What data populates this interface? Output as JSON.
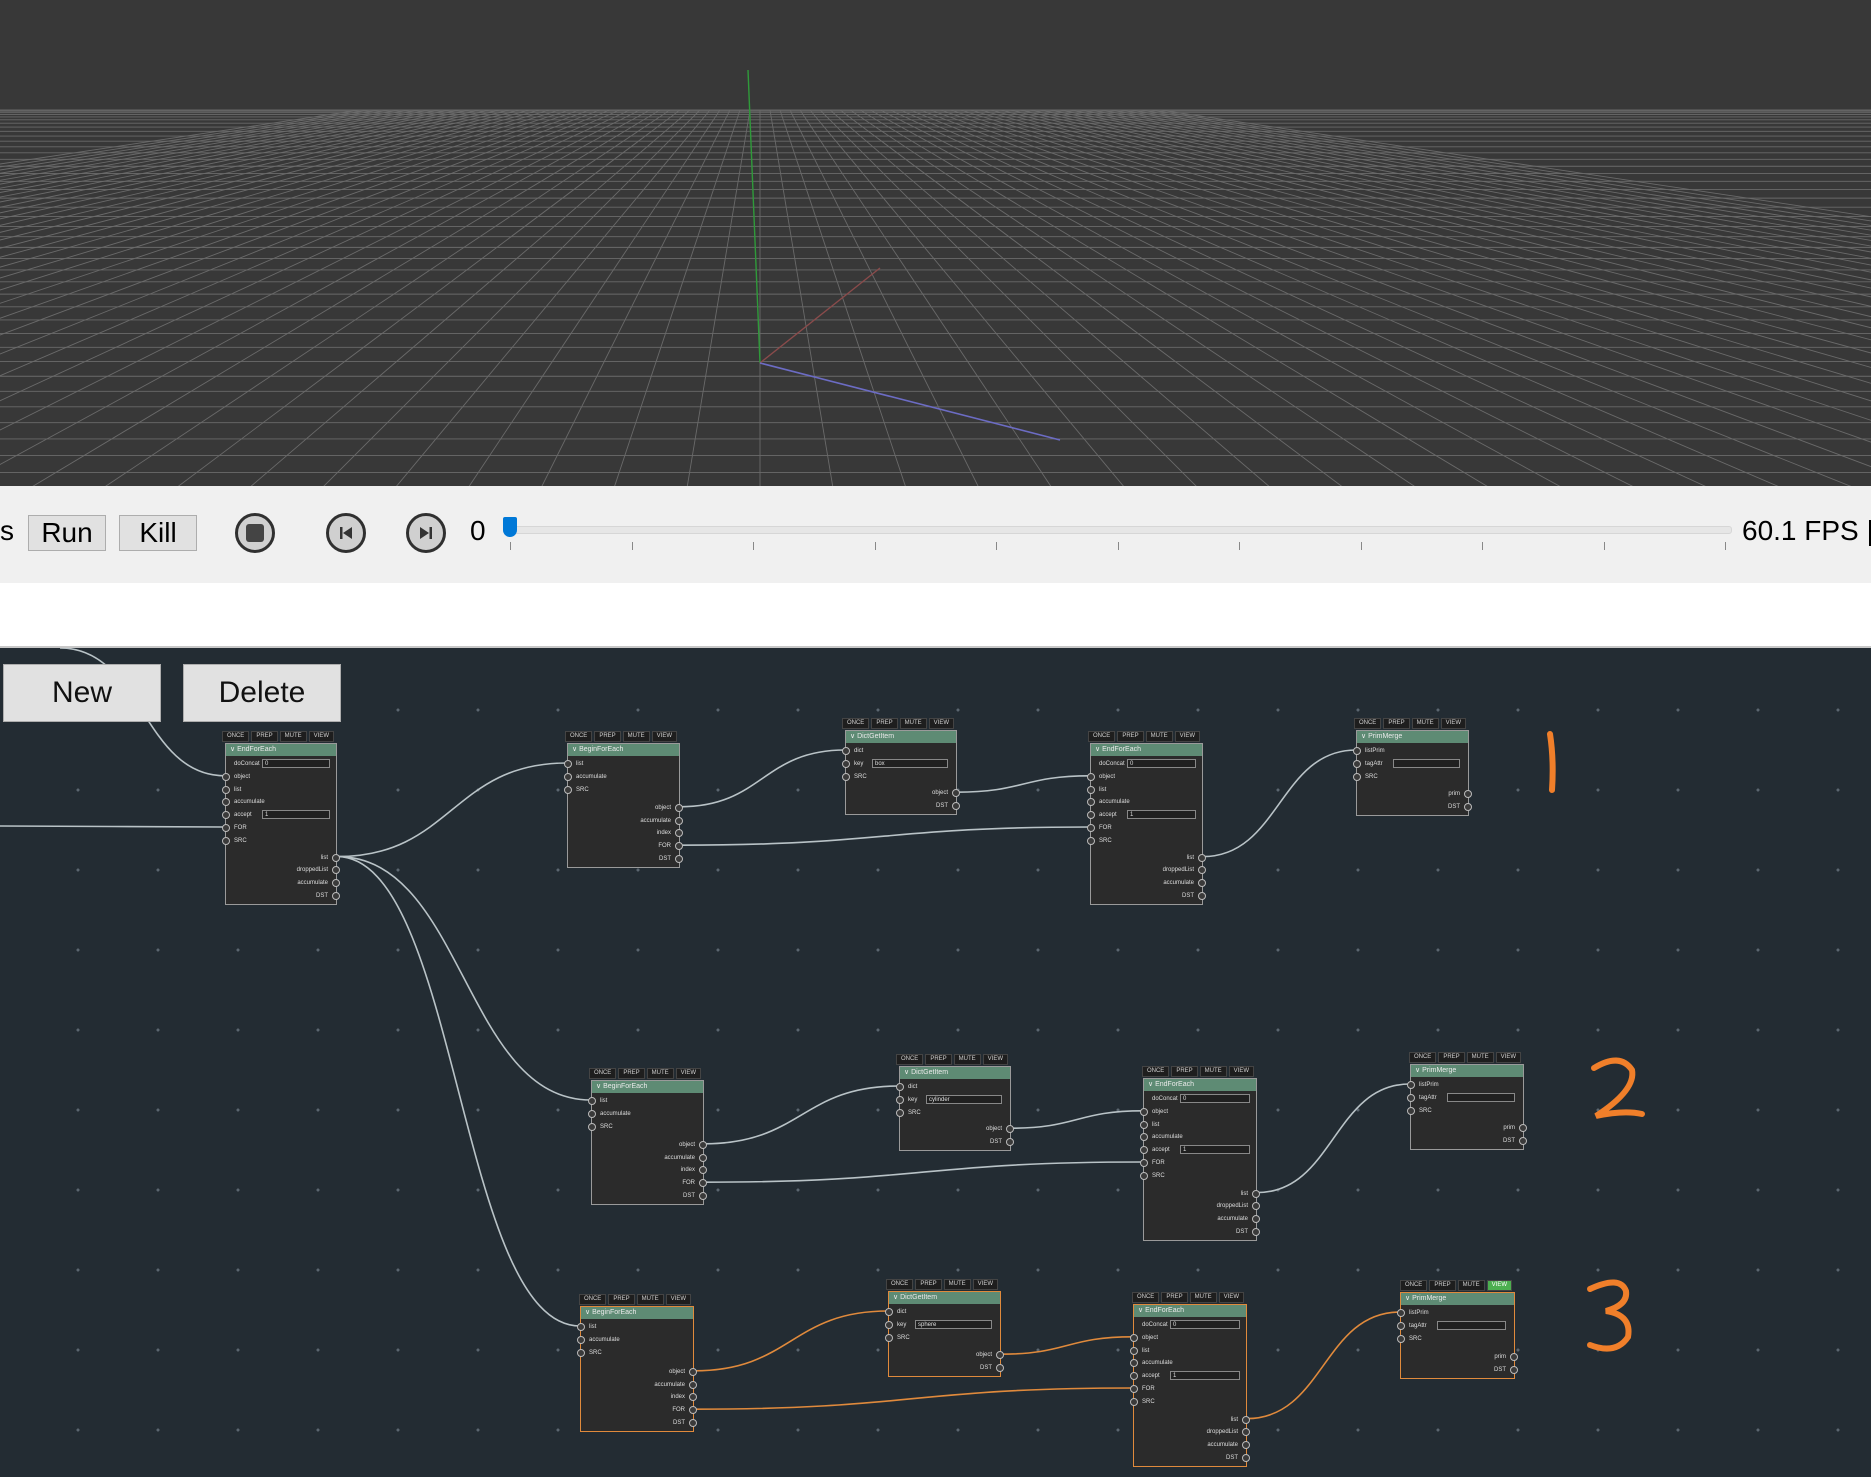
{
  "toolbar": {
    "edge_label": "s",
    "run_label": "Run",
    "kill_label": "Kill",
    "stop_icon": "stop-circle-icon",
    "prev_icon": "skip-back-icon",
    "next_icon": "skip-forward-icon",
    "frame_value": "0",
    "timeline_position": 0,
    "fps_label": "60.1 FPS |"
  },
  "graph_toolbar": {
    "new_label": "New",
    "delete_label": "Delete"
  },
  "node_controls": [
    "ONCE",
    "PREP",
    "MUTE",
    "VIEW"
  ],
  "colors": {
    "viewport_bg": "#383838",
    "editor_bg": "#232c33",
    "node_header": "#5e8b74",
    "wire": "#b9c3c7",
    "selected_wire": "#e08a3c",
    "annotation": "#f07f2a",
    "view_on": "#4caf50"
  },
  "annotations": [
    "1",
    "2",
    "3"
  ],
  "nodes": {
    "main_end": {
      "title": "EndForEach",
      "fields": {
        "doConcat": "0",
        "accept": "1"
      },
      "inputs": [
        "doConcat",
        "object",
        "list",
        "accumulate",
        "accept",
        "FOR",
        "SRC"
      ],
      "outputs": [
        "list",
        "droppedList",
        "accumulate",
        "DST"
      ]
    },
    "g1_begin": {
      "title": "BeginForEach",
      "inputs": [
        "list",
        "accumulate",
        "SRC"
      ],
      "outputs": [
        "object",
        "accumulate",
        "index",
        "FOR",
        "DST"
      ]
    },
    "g1_dict": {
      "title": "DictGetItem",
      "inputs": [
        "dict",
        "key",
        "SRC"
      ],
      "key_value": "box",
      "outputs": [
        "object",
        "DST"
      ]
    },
    "g1_end": {
      "title": "EndForEach",
      "fields": {
        "doConcat": "0",
        "accept": "1"
      },
      "inputs": [
        "doConcat",
        "object",
        "list",
        "accumulate",
        "accept",
        "FOR",
        "SRC"
      ],
      "outputs": [
        "list",
        "droppedList",
        "accumulate",
        "DST"
      ]
    },
    "g1_merge": {
      "title": "PrimMerge",
      "inputs": [
        "listPrim",
        "tagAttr",
        "SRC"
      ],
      "outputs": [
        "prim",
        "DST"
      ]
    },
    "g2_begin": {
      "title": "BeginForEach",
      "inputs": [
        "list",
        "accumulate",
        "SRC"
      ],
      "outputs": [
        "object",
        "accumulate",
        "index",
        "FOR",
        "DST"
      ]
    },
    "g2_dict": {
      "title": "DictGetItem",
      "inputs": [
        "dict",
        "key",
        "SRC"
      ],
      "key_value": "cylinder",
      "outputs": [
        "object",
        "DST"
      ]
    },
    "g2_end": {
      "title": "EndForEach",
      "fields": {
        "doConcat": "0",
        "accept": "1"
      },
      "inputs": [
        "doConcat",
        "object",
        "list",
        "accumulate",
        "accept",
        "FOR",
        "SRC"
      ],
      "outputs": [
        "list",
        "droppedList",
        "accumulate",
        "DST"
      ]
    },
    "g2_merge": {
      "title": "PrimMerge",
      "inputs": [
        "listPrim",
        "tagAttr",
        "SRC"
      ],
      "outputs": [
        "prim",
        "DST"
      ]
    },
    "g3_begin": {
      "title": "BeginForEach",
      "inputs": [
        "list",
        "accumulate",
        "SRC"
      ],
      "outputs": [
        "object",
        "accumulate",
        "index",
        "FOR",
        "DST"
      ]
    },
    "g3_dict": {
      "title": "DictGetItem",
      "inputs": [
        "dict",
        "key",
        "SRC"
      ],
      "key_value": "sphere",
      "outputs": [
        "object",
        "DST"
      ]
    },
    "g3_end": {
      "title": "EndForEach",
      "fields": {
        "doConcat": "0",
        "accept": "1"
      },
      "inputs": [
        "doConcat",
        "object",
        "list",
        "accumulate",
        "accept",
        "FOR",
        "SRC"
      ],
      "outputs": [
        "list",
        "droppedList",
        "accumulate",
        "DST"
      ]
    },
    "g3_merge": {
      "title": "PrimMerge",
      "inputs": [
        "listPrim",
        "tagAttr",
        "SRC"
      ],
      "outputs": [
        "prim",
        "DST"
      ]
    }
  }
}
